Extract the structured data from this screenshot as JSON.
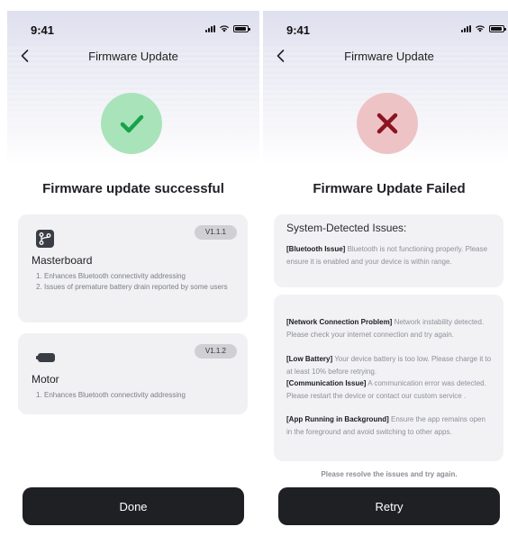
{
  "status_bar": {
    "time": "9:41"
  },
  "success_screen": {
    "nav_title": "Firmware Update",
    "headline": "Firmware update successful",
    "components": [
      {
        "version": "V1.1.1",
        "name": "Masterboard",
        "notes": [
          {
            "num": "1.",
            "text": "Enhances Bluetooth connectivity addressing"
          },
          {
            "num": "2.",
            "text": "Issues of premature battery drain reported by some users"
          }
        ]
      },
      {
        "version": "V1.1.2",
        "name": "Motor",
        "notes": [
          {
            "num": "1.",
            "text": "Enhances Bluetooth connectivity addressing"
          }
        ]
      }
    ],
    "done_label": "Done"
  },
  "failure_screen": {
    "nav_title": "Firmware Update",
    "headline": "Firmware Update Failed",
    "issues_heading": "System-Detected Issues:",
    "issues": [
      {
        "tag": "[Bluetooth Issue]",
        "text": " Bluetooth is not functioning properly. Please ensure it is enabled and your device is within range."
      },
      {
        "tag": "[Network Connection Problem]",
        "text": " Network instability detected. Please check your internet connection and try again."
      },
      {
        "tag": "[Low Battery]",
        "text": " Your device battery is too low. Please charge it to at least 10% before retrying."
      },
      {
        "tag": "[Communication Issue]",
        "text": " A communication error was detected. Please restart the device or contact our custom service ."
      },
      {
        "tag": "[App Running in Background]",
        "text": " Ensure the app remains open in the foreground and avoid switching to other apps."
      }
    ],
    "resolve_note": "Please resolve the  issues  and try again.",
    "retry_label": "Retry"
  },
  "colors": {
    "success_accent": "#17a34a",
    "success_circle": "#a9e3ba",
    "error_accent": "#8b1420",
    "error_circle": "#eec3c6",
    "button_bg": "#1e2024"
  },
  "icons": {
    "back": "chevron-left-icon",
    "success": "checkmark-icon",
    "error": "cross-icon",
    "masterboard": "branch-icon",
    "motor": "battery-pill-icon"
  }
}
